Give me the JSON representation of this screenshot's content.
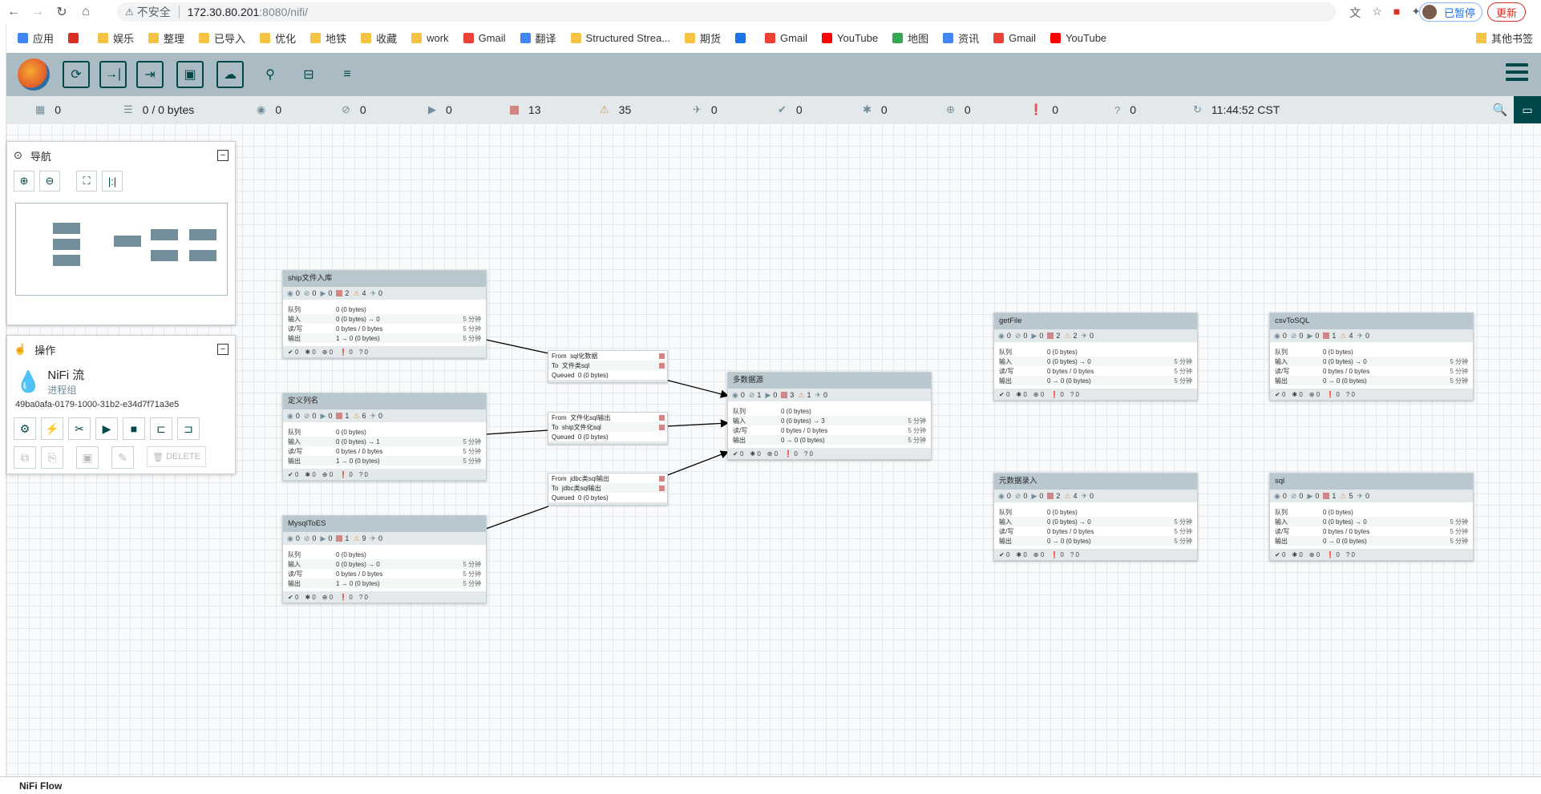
{
  "browser": {
    "url_warning": "不安全",
    "url_host": "172.30.80.201",
    "url_path": ":8080/nifi/",
    "paused_label": "已暂停",
    "update_label": "更新",
    "bookmarks": [
      {
        "label": "应用",
        "icon": "apps-grid-icon"
      },
      {
        "label": "",
        "icon": "t-icon"
      },
      {
        "label": "娱乐",
        "icon": "folder-icon"
      },
      {
        "label": "整理",
        "icon": "folder-icon"
      },
      {
        "label": "已导入",
        "icon": "folder-icon"
      },
      {
        "label": "优化",
        "icon": "folder-icon"
      },
      {
        "label": "地铁",
        "icon": "folder-icon"
      },
      {
        "label": "收藏",
        "icon": "folder-icon"
      },
      {
        "label": "work",
        "icon": "folder-icon"
      },
      {
        "label": "Gmail",
        "icon": "gmail-icon"
      },
      {
        "label": "翻译",
        "icon": "translate-icon"
      },
      {
        "label": "Structured Strea...",
        "icon": "folder-icon"
      },
      {
        "label": "期货",
        "icon": "folder-icon"
      },
      {
        "label": "",
        "icon": "c-icon"
      },
      {
        "label": "Gmail",
        "icon": "gmail-icon"
      },
      {
        "label": "YouTube",
        "icon": "youtube-icon"
      },
      {
        "label": "地图",
        "icon": "maps-icon"
      },
      {
        "label": "资讯",
        "icon": "news-icon"
      },
      {
        "label": "Gmail",
        "icon": "gmail-icon"
      },
      {
        "label": "YouTube",
        "icon": "youtube-icon"
      }
    ],
    "other_bookmarks": "其他书签"
  },
  "status": {
    "transmitting": "0",
    "queued": "0 / 0 bytes",
    "transmitting_disabled": "0",
    "not_transmitting": "0",
    "running": "0",
    "stopped": "13",
    "invalid": "35",
    "disabled": "0",
    "up_to_date": "0",
    "locally_modified": "0",
    "stale": "0",
    "modified_stale": "0",
    "sync_failure": "0",
    "refresh_time": "11:44:52 CST"
  },
  "navigate": {
    "title": "导航"
  },
  "operate": {
    "title": "操作",
    "name": "NiFi 流",
    "type": "进程组",
    "id": "49ba0afa-0179-1000-31b2-e34d7f71a3e5",
    "delete_label": "DELETE"
  },
  "groups": [
    {
      "name": "ship文件入库",
      "transmitting": "0",
      "not_transmitting": "0",
      "running": "0",
      "stopped": "2",
      "invalid": "4",
      "disabled": "0",
      "queued": "0 (0 bytes)",
      "in": "0 (0 bytes) → 0",
      "rw": "0 bytes / 0 bytes",
      "out": "1 → 0 (0 bytes)",
      "time": "5 分钟",
      "up": "0",
      "mod": "0",
      "stale": "0",
      "modstale": "0",
      "unk": "0",
      "labels": {
        "queued": "队列",
        "in": "输入",
        "rw": "读/写",
        "out": "输出"
      }
    },
    {
      "name": "定义列名",
      "transmitting": "0",
      "not_transmitting": "0",
      "running": "0",
      "stopped": "1",
      "invalid": "6",
      "disabled": "0",
      "queued": "0 (0 bytes)",
      "in": "0 (0 bytes) → 1",
      "rw": "0 bytes / 0 bytes",
      "out": "1 → 0 (0 bytes)",
      "time": "5 分钟",
      "up": "0",
      "mod": "0",
      "stale": "0",
      "modstale": "0",
      "unk": "0",
      "labels": {
        "queued": "队列",
        "in": "输入",
        "rw": "读/写",
        "out": "输出"
      }
    },
    {
      "name": "MysqlToES",
      "transmitting": "0",
      "not_transmitting": "0",
      "running": "0",
      "stopped": "1",
      "invalid": "9",
      "disabled": "0",
      "queued": "0 (0 bytes)",
      "in": "0 (0 bytes) → 0",
      "rw": "0 bytes / 0 bytes",
      "out": "1 → 0 (0 bytes)",
      "time": "5 分钟",
      "up": "0",
      "mod": "0",
      "stale": "0",
      "modstale": "0",
      "unk": "0",
      "labels": {
        "queued": "队列",
        "in": "输入",
        "rw": "读/写",
        "out": "输出"
      }
    },
    {
      "name": "多数据源",
      "transmitting": "0",
      "not_transmitting": "1",
      "running": "0",
      "stopped": "3",
      "invalid": "1",
      "disabled": "0",
      "queued": "0 (0 bytes)",
      "in": "0 (0 bytes) → 3",
      "rw": "0 bytes / 0 bytes",
      "out": "0 → 0 (0 bytes)",
      "time": "5 分钟",
      "up": "0",
      "mod": "0",
      "stale": "0",
      "modstale": "0",
      "unk": "0",
      "labels": {
        "queued": "队列",
        "in": "输入",
        "rw": "读/写",
        "out": "输出"
      }
    },
    {
      "name": "getFile",
      "transmitting": "0",
      "not_transmitting": "0",
      "running": "0",
      "stopped": "2",
      "invalid": "2",
      "disabled": "0",
      "queued": "0 (0 bytes)",
      "in": "0 (0 bytes) → 0",
      "rw": "0 bytes / 0 bytes",
      "out": "0 → 0 (0 bytes)",
      "time": "5 分钟",
      "up": "0",
      "mod": "0",
      "stale": "0",
      "modstale": "0",
      "unk": "0",
      "labels": {
        "queued": "队列",
        "in": "输入",
        "rw": "读/写",
        "out": "输出"
      }
    },
    {
      "name": "csvToSQL",
      "transmitting": "0",
      "not_transmitting": "0",
      "running": "0",
      "stopped": "1",
      "invalid": "4",
      "disabled": "0",
      "queued": "0 (0 bytes)",
      "in": "0 (0 bytes) → 0",
      "rw": "0 bytes / 0 bytes",
      "out": "0 → 0 (0 bytes)",
      "time": "5 分钟",
      "up": "0",
      "mod": "0",
      "stale": "0",
      "modstale": "0",
      "unk": "0",
      "labels": {
        "queued": "队列",
        "in": "输入",
        "rw": "读/写",
        "out": "输出"
      }
    },
    {
      "name": "元数据录入",
      "transmitting": "0",
      "not_transmitting": "0",
      "running": "0",
      "stopped": "2",
      "invalid": "4",
      "disabled": "0",
      "queued": "0 (0 bytes)",
      "in": "0 (0 bytes) → 0",
      "rw": "0 bytes / 0 bytes",
      "out": "0 → 0 (0 bytes)",
      "time": "5 分钟",
      "up": "0",
      "mod": "0",
      "stale": "0",
      "modstale": "0",
      "unk": "0",
      "labels": {
        "queued": "队列",
        "in": "输入",
        "rw": "读/写",
        "out": "输出"
      }
    },
    {
      "name": "sql",
      "transmitting": "0",
      "not_transmitting": "0",
      "running": "0",
      "stopped": "1",
      "invalid": "5",
      "disabled": "0",
      "queued": "0 (0 bytes)",
      "in": "0 (0 bytes) → 0",
      "rw": "0 bytes / 0 bytes",
      "out": "0 → 0 (0 bytes)",
      "time": "5 分钟",
      "up": "0",
      "mod": "0",
      "stale": "0",
      "modstale": "0",
      "unk": "0",
      "labels": {
        "queued": "队列",
        "in": "输入",
        "rw": "读/写",
        "out": "输出"
      }
    }
  ],
  "connections": [
    {
      "from_label": "From",
      "from": "sql化数据",
      "to_label": "To",
      "to": "文件类sql",
      "queued_label": "Queued",
      "queued": "0 (0 bytes)"
    },
    {
      "from_label": "From",
      "from": "文件化sql输出",
      "to_label": "To",
      "to": "ship文件化sql",
      "queued_label": "Queued",
      "queued": "0 (0 bytes)"
    },
    {
      "from_label": "From",
      "from": "jdbc类sql输出",
      "to_label": "To",
      "to": "jdbc类sql输出",
      "queued_label": "Queued",
      "queued": "0 (0 bytes)"
    }
  ],
  "breadcrumb": "NiFi Flow"
}
